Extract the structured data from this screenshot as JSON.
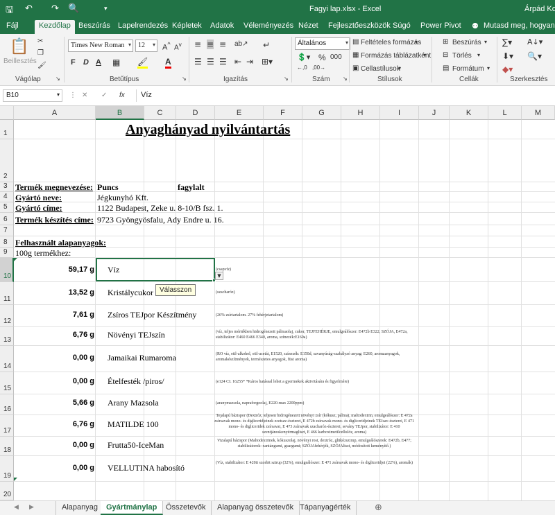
{
  "titlebar": {
    "title": "Fagyi lap.xlsx  -  Excel",
    "user": "Árpád Kov"
  },
  "menu": [
    "Fájl",
    "Kezdőlap",
    "Beszúrás",
    "Lapelrendezés",
    "Képletek",
    "Adatok",
    "Véleményezés",
    "Nézet",
    "Fejlesztőeszközök",
    "Súgó",
    "Power Pivot",
    "Mutasd meg, hogyan csi"
  ],
  "ribbon": {
    "groups": {
      "clipboard": "Vágólap",
      "font": "Betűtípus",
      "alignment": "Igazítás",
      "number": "Szám",
      "styles": "Stílusok",
      "cells": "Cellák",
      "editing": "Szerkesztés"
    },
    "paste": "Beillesztés",
    "font_name": "Times New Roman",
    "font_size": "12",
    "bold": "F",
    "italic": "D",
    "underline": "A",
    "number_format": "Általános",
    "cond_format": "Feltételes formázás",
    "format_table": "Formázás táblázatként",
    "cell_styles": "Cellastílusok",
    "insert": "Beszúrás",
    "delete": "Törlés",
    "format": "Formátum"
  },
  "formula": {
    "namebox": "B10",
    "fx": "fx",
    "content": "Víz"
  },
  "columns": [
    "A",
    "B",
    "C",
    "D",
    "E",
    "F",
    "G",
    "H",
    "I",
    "J",
    "K",
    "L",
    "M"
  ],
  "rows": [
    "1",
    "2",
    "3",
    "4",
    "5",
    "6",
    "7",
    "8",
    "9",
    "10",
    "11",
    "12",
    "13",
    "14",
    "15",
    "16",
    "17",
    "18",
    "19",
    "20"
  ],
  "sheet": {
    "title": "Anyaghányad nyilvántartás",
    "labels": {
      "product": "Termék megnevezése:",
      "maker": "Gyártó neve:",
      "addr": "Gyártó címe:",
      "site": "Termék készítés címe:",
      "used": "Felhasznált alapanyagok:",
      "per100": "100g termékhez:"
    },
    "values": {
      "product": "Puncs",
      "product_type": "fagylalt",
      "maker": "Jégkunyhó Kft.",
      "addr": "1122 Budapest, Zeke u. 8-10/B fsz. 1.",
      "site": "9723 Gyöngyösfalu, Ady Endre u. 16."
    },
    "ingredients": [
      {
        "qty": "59,17 g",
        "name": "Víz",
        "desc": "(csapvíz)"
      },
      {
        "qty": "13,52 g",
        "name": "Kristálycukor",
        "desc": "(szacharóz)"
      },
      {
        "qty": "7,61 g",
        "name": "Zsíros TEJpor Készítmény",
        "desc": "(26% zsírtartalom. 27% fehérjetartalom)"
      },
      {
        "qty": "6,76 g",
        "name": "Növényi TEJszín",
        "desc": "(víz, teljes mértékben hidrogénezett pálmaolaj, cukor, TEJFEHÉRJE, emulgeálószer: E472b E322, SZÓJA, E472a, stabilizátor: E460 E466 E340, aroma, színezék:E160a)"
      },
      {
        "qty": "0,00 g",
        "name": "Jamaikai Rumaroma",
        "desc": "(RO víz, etil-alkohol, etil-acetát, E1520, színezék: E150d, savanyúság-szabályzó anyag: E260, aromaanyagok, aromakészítmények, természetes anyagok, füst aroma)"
      },
      {
        "qty": "0,00 g",
        "name": "Ételfesték /piros/",
        "desc": "(e124 CI. 16255* *Káros hatással lehet a gyermekek aktivitására és figyelmére)"
      },
      {
        "qty": "5,66 g",
        "name": "Arany Mazsola",
        "desc": "(aranymazsola, napraforgoolaj, E220-max 2200ppm)"
      },
      {
        "qty": "6,76 g",
        "name": "MATILDE 100",
        "desc": "Tejalapú bázispor (Dextróz, teljesen hidrogénezett növényi zsír (kókusz, pálma), maltodextrin, emulgeálószer: E 472a zsírsavak mono- és digliceridjeinek ecetsav-észterei, E 472b zsírsavak mono- és digliceridjeinek TEJsav-észterei, E 471 mono- és digliceridek zsírsavai, E 473 zsírsavak szacharóz-észterei, sovány TEJpor, stabilizátor: E 410 szentjánoskenyérmagliszt, E 466 karboximetilcellulóz, aroma)"
      },
      {
        "qty": "0,00 g",
        "name": "Frutta50-IceMan",
        "desc": "Vizalapú bázispor (Maltodextrinek, kókuszolaj, növényi rost, dextróz, glükózszirup, emulgeálószerek: E472b, E477; stabilizátorok: xantángumi, guargumi; SZÓJAfehérjék, SZÓJAliszt, módosított keményítő.)"
      },
      {
        "qty": "0,00 g",
        "name": "VELLUTINA habosító",
        "desc": "(Víz, stabilizátor: E 420ii szorbit szirup (32%), emulgeálószer: E 471 zsírsavak mono- és digliceridjei (22%), aromák)"
      }
    ],
    "tooltip": "Válasszon"
  },
  "tabs": [
    "Alapanyag",
    "Gyártmánylap",
    "Összetevők",
    "Alapanyag összetevők",
    "Tápanyagérték"
  ],
  "active_tab": "Gyártmánylap",
  "colors": {
    "accent": "#217346"
  }
}
